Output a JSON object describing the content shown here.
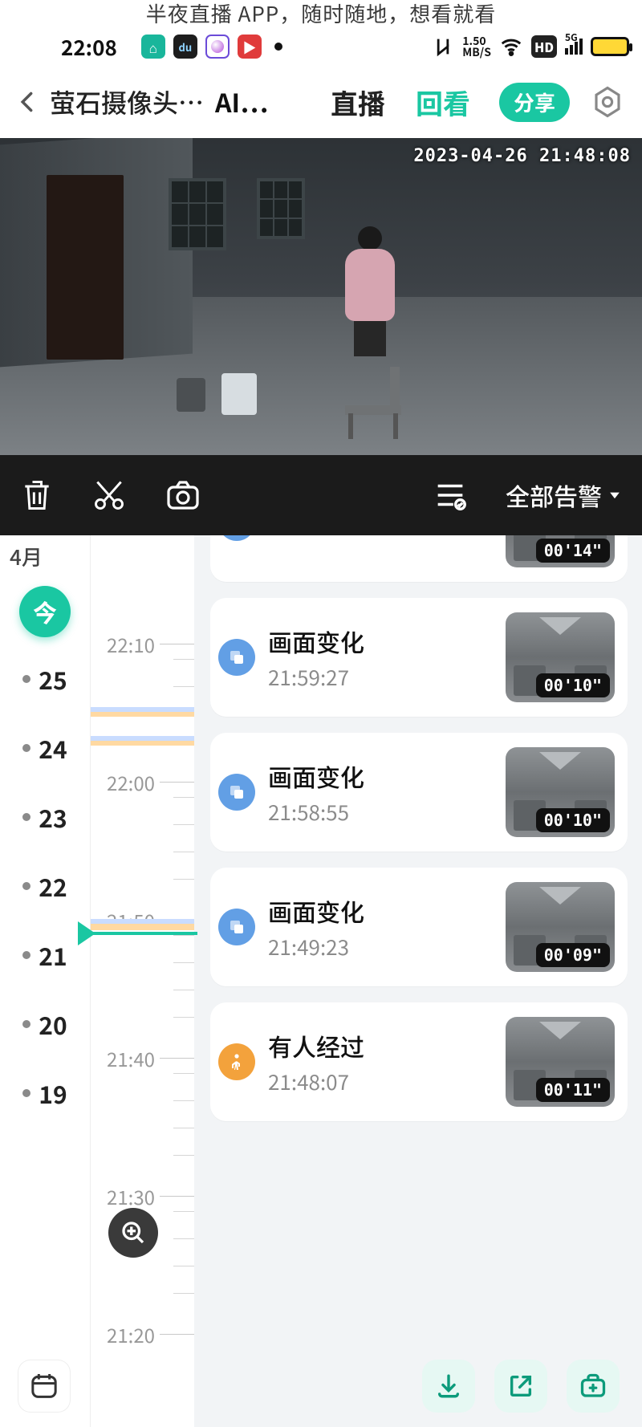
{
  "ad_banner": "半夜直播 APP，随时随地，想看就看",
  "status": {
    "time": "22:08",
    "net_speed_top": "1.50",
    "net_speed_bottom": "MB/S",
    "hd": "HD",
    "net_label": "5G"
  },
  "header": {
    "title": "萤石摄像头…",
    "ai": "AI…",
    "tab_live": "直播",
    "tab_playback": "回看",
    "share": "分享"
  },
  "video": {
    "overlay_timestamp": "2023-04-26 21:48:08"
  },
  "toolbar": {
    "filter_label": "全部告警"
  },
  "date_rail": {
    "month": "4月",
    "today": "今",
    "days": [
      "25",
      "24",
      "23",
      "22",
      "21",
      "20",
      "19"
    ]
  },
  "timeline": {
    "ticks": [
      "22:10",
      "22:00",
      "21:50",
      "21:40",
      "21:30",
      "21:20"
    ]
  },
  "events": [
    {
      "kind": "partial",
      "icon": "blue",
      "title": "",
      "time": "",
      "duration": "00'14\""
    },
    {
      "kind": "full",
      "icon": "blue",
      "title": "画面变化",
      "time": "21:59:27",
      "duration": "00'10\""
    },
    {
      "kind": "full",
      "icon": "blue",
      "title": "画面变化",
      "time": "21:58:55",
      "duration": "00'10\""
    },
    {
      "kind": "full",
      "icon": "blue",
      "title": "画面变化",
      "time": "21:49:23",
      "duration": "00'09\""
    },
    {
      "kind": "full",
      "icon": "orange",
      "title": "有人经过",
      "time": "21:48:07",
      "duration": "00'11\""
    }
  ]
}
